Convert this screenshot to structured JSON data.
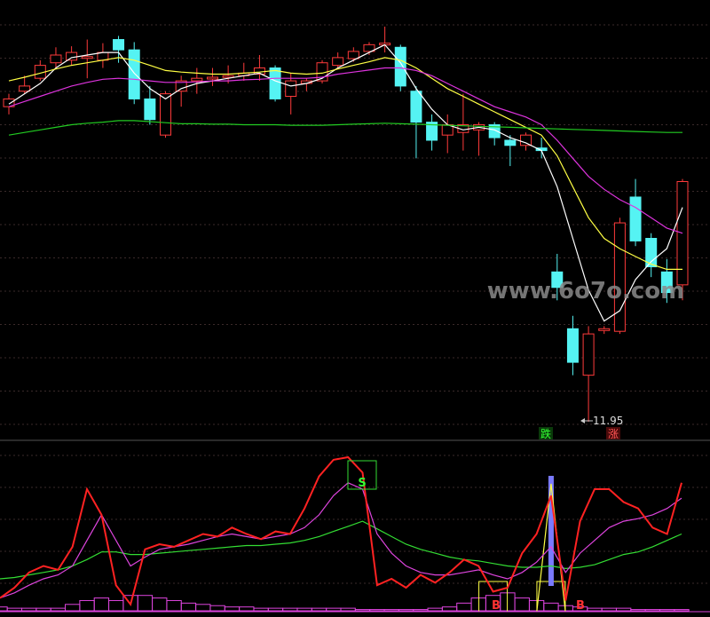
{
  "watermark": "www.6o7o.com",
  "colors": {
    "background": "#000000",
    "up": "#ff3b3b",
    "down": "#55f3f3",
    "ma_white": "#ffffff",
    "ma_yellow": "#ffff44",
    "ma_magenta": "#dd33dd",
    "ma_green": "#22cc22",
    "osc_red": "#ff2222",
    "osc_magenta": "#dd44dd",
    "osc_green": "#33dd33",
    "marker_yellow": "#ffff44",
    "spike_blue": "#7a7aff",
    "grid": "#3a2a2a",
    "separator": "#555555"
  },
  "price_labels": {
    "low_value": "11.95",
    "fall_mark": "跌",
    "rise_mark": "涨"
  },
  "signal_labels": {
    "sell": "S",
    "buy_1": "B",
    "buy_2": "B"
  },
  "chart_data": {
    "type": "candlestick",
    "title": "",
    "candles": [
      {
        "o": 0.55,
        "c": 0.7,
        "h": 0.8,
        "l": 0.4
      },
      {
        "o": 0.85,
        "c": 0.95,
        "h": 1.15,
        "l": 0.8
      },
      {
        "o": 1.1,
        "c": 1.35,
        "h": 1.45,
        "l": 1.05
      },
      {
        "o": 1.4,
        "c": 1.55,
        "h": 1.7,
        "l": 1.3
      },
      {
        "o": 1.45,
        "c": 1.6,
        "h": 1.72,
        "l": 1.35
      },
      {
        "o": 1.5,
        "c": 1.52,
        "h": 1.85,
        "l": 1.1
      },
      {
        "o": 1.45,
        "c": 1.6,
        "h": 1.78,
        "l": 1.3
      },
      {
        "o": 1.85,
        "c": 1.65,
        "h": 1.92,
        "l": 1.4
      },
      {
        "o": 1.65,
        "c": 0.7,
        "h": 1.8,
        "l": 0.6
      },
      {
        "o": 0.7,
        "c": 0.3,
        "h": 0.95,
        "l": 0.2
      },
      {
        "o": 0.0,
        "c": 0.8,
        "h": 0.85,
        "l": -0.05
      },
      {
        "o": 0.85,
        "c": 1.05,
        "h": 1.15,
        "l": 0.55
      },
      {
        "o": 1.05,
        "c": 1.1,
        "h": 1.3,
        "l": 0.8
      },
      {
        "o": 1.1,
        "c": 1.12,
        "h": 1.3,
        "l": 0.95
      },
      {
        "o": 1.12,
        "c": 1.15,
        "h": 1.35,
        "l": 1.0
      },
      {
        "o": 1.15,
        "c": 1.2,
        "h": 1.4,
        "l": 1.05
      },
      {
        "o": 1.18,
        "c": 1.3,
        "h": 1.55,
        "l": 1.05
      },
      {
        "o": 1.3,
        "c": 0.7,
        "h": 1.35,
        "l": 0.65
      },
      {
        "o": 0.75,
        "c": 1.05,
        "h": 1.2,
        "l": 0.4
      },
      {
        "o": 1.0,
        "c": 1.05,
        "h": 1.1,
        "l": 0.85
      },
      {
        "o": 1.05,
        "c": 1.4,
        "h": 1.45,
        "l": 1.0
      },
      {
        "o": 1.35,
        "c": 1.5,
        "h": 1.6,
        "l": 1.3
      },
      {
        "o": 1.48,
        "c": 1.62,
        "h": 1.7,
        "l": 1.42
      },
      {
        "o": 1.62,
        "c": 1.75,
        "h": 1.8,
        "l": 1.55
      },
      {
        "o": 1.75,
        "c": 1.78,
        "h": 2.1,
        "l": 1.6
      },
      {
        "o": 1.7,
        "c": 0.95,
        "h": 1.75,
        "l": 0.85
      },
      {
        "o": 0.85,
        "c": 0.25,
        "h": 0.95,
        "l": -0.45
      },
      {
        "o": 0.25,
        "c": -0.1,
        "h": 0.4,
        "l": -0.3
      },
      {
        "o": 0.0,
        "c": 0.2,
        "h": 0.4,
        "l": -0.35
      },
      {
        "o": 0.05,
        "c": 0.2,
        "h": 0.8,
        "l": -0.3
      },
      {
        "o": 0.1,
        "c": 0.2,
        "h": 0.25,
        "l": -0.4
      },
      {
        "o": 0.2,
        "c": -0.05,
        "h": 0.25,
        "l": -0.2
      },
      {
        "o": -0.1,
        "c": -0.2,
        "h": 0.0,
        "l": -0.6
      },
      {
        "o": -0.2,
        "c": 0.0,
        "h": 0.05,
        "l": -0.3
      },
      {
        "o": -0.25,
        "c": -0.3,
        "h": -0.05,
        "l": -0.45
      },
      {
        "o": -2.65,
        "c": -2.95,
        "h": -2.3,
        "l": -3.2
      },
      {
        "o": -3.75,
        "c": -4.4,
        "h": -3.5,
        "l": -4.65
      },
      {
        "o": -4.65,
        "c": -3.85,
        "h": -3.7,
        "l": -5.55
      },
      {
        "o": -3.75,
        "c": -3.75,
        "h": -3.7,
        "l": -3.85
      },
      {
        "o": -3.8,
        "c": -1.7,
        "h": -1.6,
        "l": -3.85
      },
      {
        "o": -1.2,
        "c": -2.05,
        "h": -0.85,
        "l": -2.15
      },
      {
        "o": -2.0,
        "c": -2.55,
        "h": -1.9,
        "l": -2.75
      },
      {
        "o": -2.65,
        "c": -3.05,
        "h": -2.4,
        "l": -3.25
      },
      {
        "o": -2.9,
        "c": -0.9,
        "h": -0.85,
        "l": -3.2
      }
    ],
    "ma": [
      {
        "name": "",
        "values": [
          0.6,
          0.8,
          1.0,
          1.3,
          1.5,
          1.55,
          1.6,
          1.6,
          1.2,
          0.9,
          0.7,
          0.9,
          1.0,
          1.05,
          1.1,
          1.15,
          1.2,
          1.05,
          0.95,
          1.0,
          1.1,
          1.3,
          1.45,
          1.6,
          1.75,
          1.4,
          0.9,
          0.5,
          0.2,
          0.1,
          0.15,
          0.1,
          -0.05,
          -0.15,
          -0.3,
          -1.0,
          -2.0,
          -3.0,
          -3.6,
          -3.4,
          -2.8,
          -2.45,
          -2.2,
          -1.4
        ]
      },
      {
        "name": "",
        "values": [
          1.05,
          1.12,
          1.2,
          1.28,
          1.35,
          1.4,
          1.45,
          1.5,
          1.45,
          1.35,
          1.25,
          1.22,
          1.2,
          1.18,
          1.18,
          1.2,
          1.22,
          1.25,
          1.2,
          1.18,
          1.2,
          1.28,
          1.35,
          1.42,
          1.5,
          1.45,
          1.3,
          1.1,
          0.9,
          0.75,
          0.6,
          0.45,
          0.3,
          0.15,
          0.0,
          -0.4,
          -1.0,
          -1.6,
          -2.0,
          -2.2,
          -2.35,
          -2.5,
          -2.6,
          -2.6
        ]
      },
      {
        "name": "",
        "values": [
          0.55,
          0.65,
          0.75,
          0.85,
          0.95,
          1.02,
          1.08,
          1.1,
          1.08,
          1.05,
          1.02,
          1.02,
          1.03,
          1.05,
          1.05,
          1.07,
          1.08,
          1.1,
          1.1,
          1.1,
          1.12,
          1.18,
          1.22,
          1.26,
          1.3,
          1.3,
          1.25,
          1.15,
          1.0,
          0.85,
          0.7,
          0.55,
          0.45,
          0.35,
          0.2,
          -0.1,
          -0.45,
          -0.8,
          -1.05,
          -1.25,
          -1.4,
          -1.6,
          -1.8,
          -1.9
        ]
      },
      {
        "name": "",
        "values": [
          0.0,
          0.05,
          0.1,
          0.15,
          0.2,
          0.23,
          0.25,
          0.28,
          0.28,
          0.26,
          0.24,
          0.22,
          0.22,
          0.21,
          0.21,
          0.2,
          0.2,
          0.2,
          0.19,
          0.19,
          0.19,
          0.2,
          0.21,
          0.22,
          0.23,
          0.22,
          0.21,
          0.2,
          0.19,
          0.18,
          0.17,
          0.16,
          0.15,
          0.14,
          0.13,
          0.12,
          0.11,
          0.1,
          0.09,
          0.08,
          0.07,
          0.06,
          0.05,
          0.05
        ]
      }
    ],
    "low_marker": {
      "index": 37,
      "value": 11.95
    },
    "oscillator": {
      "series": [
        {
          "name": "",
          "values": [
            10,
            18,
            30,
            35,
            32,
            50,
            95,
            75,
            20,
            5,
            48,
            52,
            50,
            55,
            60,
            58,
            65,
            60,
            56,
            62,
            60,
            80,
            105,
            118,
            120,
            108,
            20,
            25,
            18,
            28,
            22,
            30,
            40,
            35,
            15,
            18,
            45,
            60,
            90,
            8,
            70,
            95,
            95,
            85,
            80,
            65,
            60,
            100
          ]
        },
        {
          "name": "",
          "values": [
            10,
            14,
            20,
            25,
            28,
            35,
            55,
            75,
            55,
            35,
            42,
            48,
            50,
            52,
            55,
            58,
            60,
            58,
            56,
            58,
            60,
            65,
            75,
            90,
            100,
            95,
            60,
            45,
            35,
            30,
            28,
            28,
            30,
            32,
            28,
            25,
            30,
            38,
            50,
            30,
            45,
            55,
            65,
            70,
            72,
            75,
            80,
            88
          ]
        },
        {
          "name": "",
          "values": [
            25,
            26,
            28,
            30,
            32,
            35,
            40,
            46,
            46,
            44,
            44,
            45,
            46,
            47,
            48,
            49,
            50,
            51,
            51,
            52,
            53,
            55,
            58,
            62,
            66,
            70,
            64,
            58,
            52,
            48,
            45,
            42,
            40,
            39,
            37,
            35,
            34,
            34,
            35,
            33,
            34,
            36,
            40,
            44,
            46,
            50,
            55,
            60
          ]
        }
      ],
      "bars": [
        3,
        2,
        2,
        2,
        2,
        5,
        8,
        10,
        8,
        12,
        12,
        10,
        8,
        6,
        5,
        4,
        3,
        3,
        2,
        2,
        2,
        2,
        2,
        2,
        2,
        1,
        1,
        1,
        1,
        1,
        2,
        3,
        6,
        10,
        12,
        14,
        10,
        8,
        6,
        4,
        3,
        2,
        2,
        2,
        1,
        1,
        1,
        1
      ],
      "spike_index": 38,
      "sell_index": 25,
      "buy_indices": [
        34,
        38
      ]
    }
  }
}
